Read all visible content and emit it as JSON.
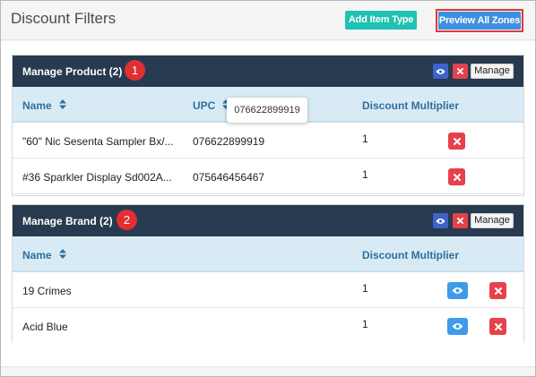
{
  "header": {
    "title": "Discount Filters",
    "add_item_type_label": "Add Item Type",
    "preview_all_zones_label": "Preview All Zones"
  },
  "colors": {
    "panel_header": "#283a4f",
    "table_header_bg": "#d8ebf5",
    "table_header_text": "#2f6f9b",
    "delete_red": "#e7414b",
    "view_blue": "#3d9be9",
    "teal_button": "#1fc1b4",
    "highlight_border": "#e0383b"
  },
  "product_panel": {
    "title": "Manage Product (2)",
    "annotation": "1",
    "manage_label": "Manage",
    "columns": {
      "name": "Name",
      "upc": "UPC",
      "multiplier": "Discount Multiplier"
    },
    "rows": [
      {
        "name": "\"60\" Nic Sesenta Sampler Bx/...",
        "upc": "076622899919",
        "multiplier": "1"
      },
      {
        "name": "#36 Sparkler Display Sd002A...",
        "upc": "075646456467",
        "multiplier": "1"
      }
    ],
    "tooltip": "076622899919"
  },
  "brand_panel": {
    "title": "Manage Brand (2)",
    "annotation": "2",
    "manage_label": "Manage",
    "columns": {
      "name": "Name",
      "multiplier": "Discount Multiplier"
    },
    "rows": [
      {
        "name": "19 Crimes",
        "multiplier": "1"
      },
      {
        "name": "Acid Blue",
        "multiplier": "1"
      }
    ]
  },
  "icons": [
    "eye-icon",
    "close-icon",
    "sort-icon"
  ]
}
